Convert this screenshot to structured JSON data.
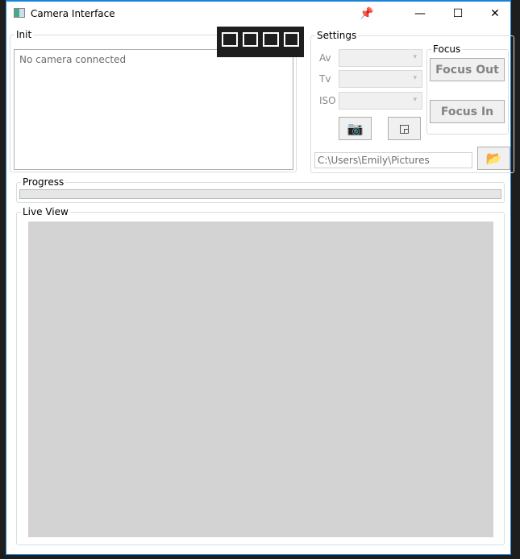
{
  "window": {
    "title": "Camera Interface",
    "controls": [
      "pin",
      "minimize",
      "maximize",
      "close"
    ]
  },
  "init": {
    "legend": "Init",
    "log_text": "No camera connected"
  },
  "settings": {
    "legend": "Settings",
    "av_label": "Av",
    "tv_label": "Tv",
    "iso_label": "ISO",
    "av_value": "",
    "tv_value": "",
    "iso_value": "",
    "save_path": "C:\\Users\\Emily\\Pictures"
  },
  "focus": {
    "legend": "Focus",
    "focus_out": "Focus Out",
    "focus_in": "Focus In"
  },
  "progress": {
    "legend": "Progress",
    "value": 0
  },
  "live_view": {
    "legend": "Live View"
  }
}
